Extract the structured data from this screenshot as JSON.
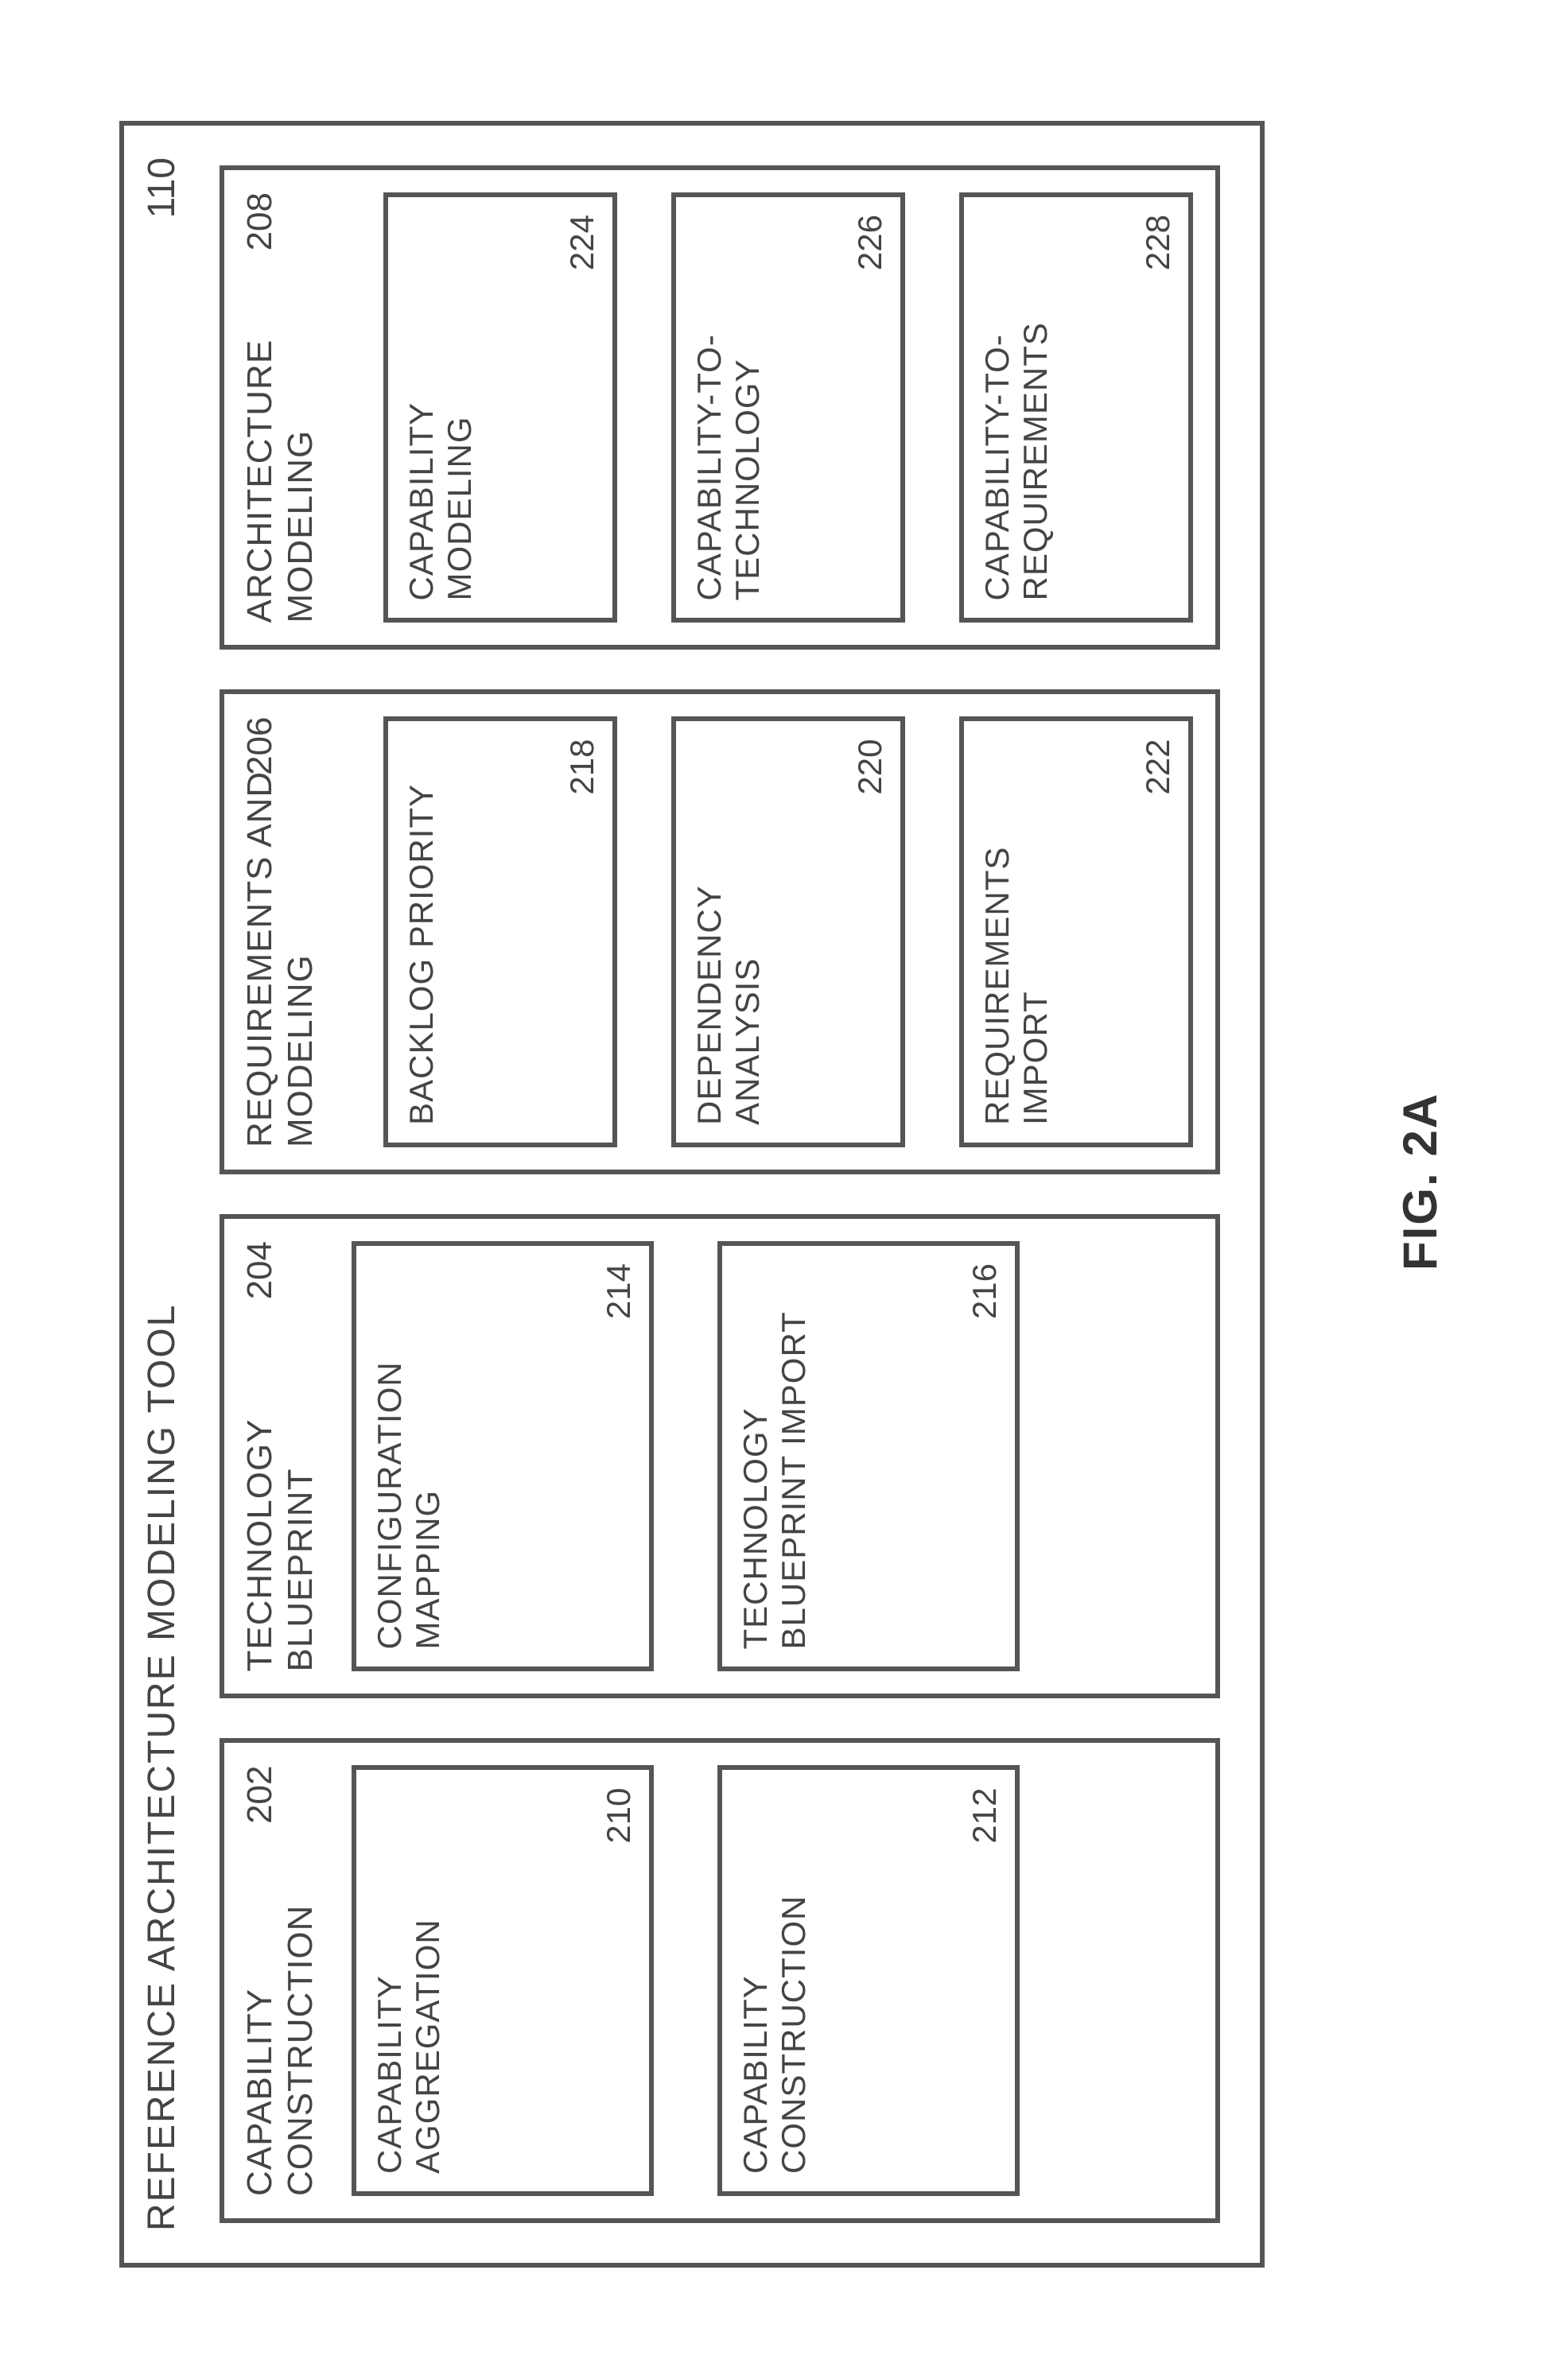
{
  "figure_caption": "FIG. 2A",
  "outer": {
    "title": "REFERENCE ARCHITECTURE MODELING TOOL",
    "number": "110"
  },
  "columns": [
    {
      "title": "CAPABILITY CONSTRUCTION",
      "number": "202",
      "subs": [
        {
          "title": "CAPABILITY AGGREGATION",
          "number": "210"
        },
        {
          "title": "CAPABILITY CONSTRUCTION",
          "number": "212"
        }
      ]
    },
    {
      "title": "TECHNOLOGY BLUEPRINT",
      "number": "204",
      "subs": [
        {
          "title": "CONFIGURATION MAPPING",
          "number": "214"
        },
        {
          "title": "TECHNOLOGY BLUEPRINT IMPORT",
          "number": "216"
        }
      ]
    },
    {
      "title": "REQUIREMENTS AND MODELING",
      "number": "206",
      "subs": [
        {
          "title": "BACKLOG PRIORITY",
          "number": "218"
        },
        {
          "title": "DEPENDENCY ANALYSIS",
          "number": "220"
        },
        {
          "title": "REQUIREMENTS IMPORT",
          "number": "222"
        }
      ]
    },
    {
      "title": "ARCHITECTURE MODELING",
      "number": "208",
      "subs": [
        {
          "title": "CAPABILITY MODELING",
          "number": "224"
        },
        {
          "title": "CAPABILITY-TO-TECHNOLOGY",
          "number": "226"
        },
        {
          "title": "CAPABILITY-TO-REQUIREMENTS",
          "number": "228"
        }
      ]
    }
  ]
}
